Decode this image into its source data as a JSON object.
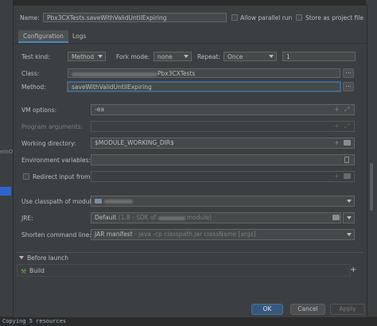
{
  "background": {
    "left_fragment": "elnO",
    "console_text": "Copying 5 resources"
  },
  "header": {
    "name_label": "Name:",
    "name_value": "Pbx3CXTests.saveWithValidUntilExpiring",
    "allow_parallel_label": "Allow parallel run",
    "store_project_label": "Store as project file"
  },
  "tabs": [
    {
      "label": "Configuration",
      "active": true
    },
    {
      "label": "Logs",
      "active": false
    }
  ],
  "form": {
    "test_kind_label": "Test kind:",
    "test_kind_value": "Method",
    "fork_mode_label": "Fork mode:",
    "fork_mode_value": "none",
    "repeat_label": "Repeat:",
    "repeat_value": "Once",
    "repeat_count": "1",
    "class_label": "Class:",
    "class_value_suffix": "Pbx3CXTests",
    "method_label": "Method:",
    "method_value": "saveWithValidUntilExpiring",
    "vm_options_label": "VM options:",
    "vm_options_value": "-ea",
    "program_args_label": "Program arguments:",
    "working_dir_label": "Working directory:",
    "working_dir_value": "$MODULE_WORKING_DIR$",
    "env_vars_label": "Environment variables:",
    "redirect_input_label": "Redirect input from:",
    "classpath_label": "Use classpath of module:",
    "jre_label": "JRE:",
    "jre_value": "Default",
    "jre_detail_prefix": "(1.8 - SDK of",
    "jre_detail_suffix": "module)",
    "shorten_label": "Shorten command line:",
    "shorten_value": "JAR manifest",
    "shorten_detail": "- java -cp classpath.jar className [args]"
  },
  "before_launch": {
    "section_label": "Before launch",
    "items": [
      "Build"
    ]
  },
  "buttons": {
    "ok": "OK",
    "cancel": "Cancel",
    "apply": "Apply"
  },
  "icons": {
    "browse": "...",
    "plus": "+",
    "expand": "⤢"
  },
  "colors": {
    "accent": "#4a88c7",
    "primary_button": "#365880"
  }
}
